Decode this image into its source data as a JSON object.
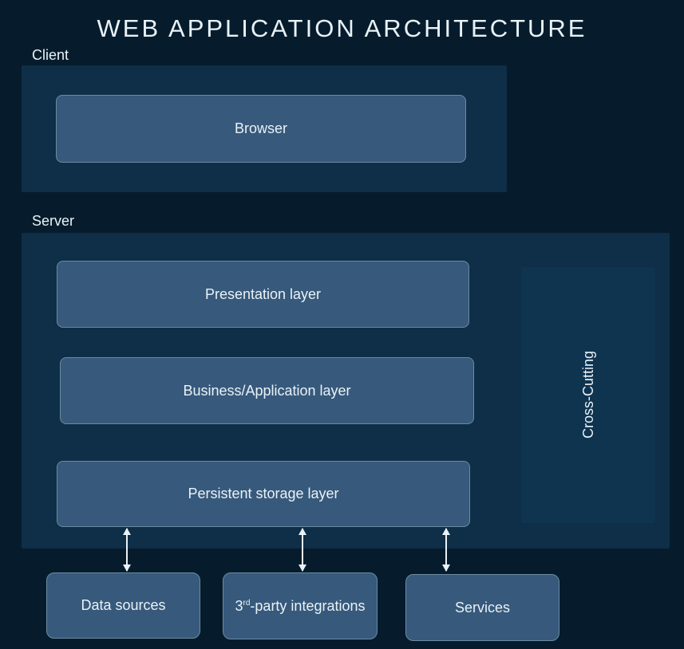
{
  "title": "WEB APPLICATION ARCHITECTURE",
  "sections": {
    "client": "Client",
    "server": "Server"
  },
  "boxes": {
    "browser": "Browser",
    "presentation": "Presentation layer",
    "business": "Business/Application layer",
    "persistent": "Persistent storage layer",
    "crosscutting": "Cross-Cutting",
    "datasources": "Data sources",
    "thirdparty_prefix": "3",
    "thirdparty_suffix": "-party integrations",
    "thirdparty_ord": "rd",
    "services": "Services"
  }
}
